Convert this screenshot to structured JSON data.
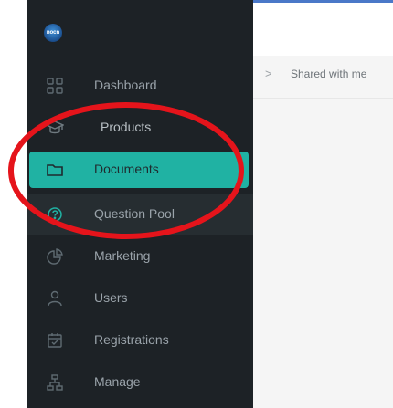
{
  "brand": {
    "logo_text": "nocn"
  },
  "sidebar": {
    "items": [
      {
        "label": "Dashboard",
        "icon": "grid-icon"
      },
      {
        "label": "Products",
        "icon": "graduation-cap-icon"
      },
      {
        "label": "Documents",
        "icon": "folder-icon",
        "active": true
      },
      {
        "label": "Question Pool",
        "icon": "question-circle-icon"
      },
      {
        "label": "Marketing",
        "icon": "pie-chart-icon"
      },
      {
        "label": "Users",
        "icon": "user-icon"
      },
      {
        "label": "Registrations",
        "icon": "calendar-check-icon"
      },
      {
        "label": "Manage",
        "icon": "sitemap-icon"
      }
    ]
  },
  "breadcrumb": {
    "separator": ">",
    "current": "Shared with me"
  },
  "colors": {
    "sidebar_bg": "#1d2226",
    "active_bg": "#20b2a3",
    "annotation": "#e5141b"
  }
}
